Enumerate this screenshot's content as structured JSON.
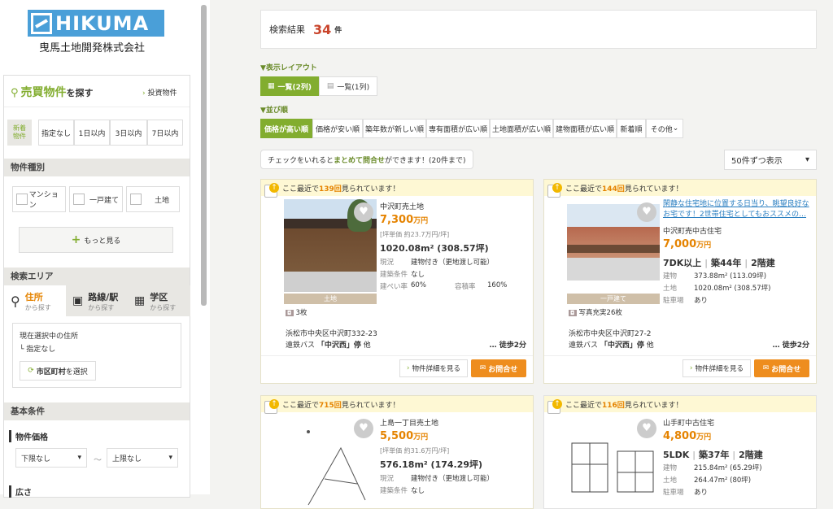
{
  "brand": {
    "logo": "HIKUMA",
    "company": "曳馬土地開発株式会社"
  },
  "sidebar": {
    "search_title": "売買物件",
    "search_suffix": "を探す",
    "invest_link": "投資物件",
    "new_label": "新着物件",
    "new_filters": [
      "指定なし",
      "1日以内",
      "3日以内",
      "7日以内"
    ],
    "type_title": "物件種別",
    "types": [
      "マンション",
      "一戸建て",
      "土地"
    ],
    "more": "もっと見る",
    "area_title": "検索エリア",
    "area_tabs": [
      {
        "label": "住所",
        "sub": "から探す"
      },
      {
        "label": "路線/駅",
        "sub": "から探す"
      },
      {
        "label": "学区",
        "sub": "から探す"
      }
    ],
    "current_label": "現在選択中の住所",
    "current_value": "└ 指定なし",
    "city_button": "市区町村",
    "city_button_suffix": "を選択",
    "basic_title": "基本条件",
    "price_label": "物件価格",
    "price_min": "下限なし",
    "price_max": "上限なし",
    "tilde": "～",
    "area_label": "広さ"
  },
  "results": {
    "label": "検索結果",
    "count": "34",
    "unit": "件"
  },
  "layout": {
    "label": "▼表示レイアウト",
    "options": [
      "一覧(2列)",
      "一覧(1列)"
    ]
  },
  "sort": {
    "label": "▼並び順",
    "options": [
      "価格が高い順",
      "価格が安い順",
      "築年数が新しい順",
      "専有面積が広い順",
      "土地面積が広い順",
      "建物面積が広い順",
      "新着順",
      "その他"
    ]
  },
  "bulk": {
    "pre": "チェックをいれると",
    "bold": "まとめて問合せ",
    "post": "ができます！(20件まで)"
  },
  "per_page": "50件ずつ表示",
  "cards": [
    {
      "views_pre": "ここ最近で",
      "views": "139回",
      "views_post": "見られています！",
      "title": "中沢町売土地",
      "price": "7,300",
      "price_unit": "万円",
      "unit_price": "[坪単価 約23.7万円/坪]",
      "area": "1020.08m² (308.57坪)",
      "k1": "現況",
      "v1": "建物付き（更地渡し可能）",
      "k2": "建築条件",
      "v2": "なし",
      "k3": "建ぺい率",
      "v3": "60%",
      "k4": "容積率",
      "v4": "160%",
      "tag": "土地",
      "photos": "3枚",
      "address": "浜松市中央区中沢町332-23",
      "bus": "遠鉄バス",
      "stop": "「中沢西」停",
      "stop_suffix": "他",
      "walk": "… 徒歩2分",
      "detail": "物件詳細を見る",
      "inquiry": "お問合せ"
    },
    {
      "views_pre": "ここ最近で",
      "views": "144回",
      "views_post": "見られています！",
      "headline": "閑静な住宅地に位置する日当り、眺望良好なお宅です！2世帯住宅としてもおススメの…",
      "title": "中沢町売中古住宅",
      "price": "7,000",
      "price_unit": "万円",
      "layout": "7DK以上",
      "age": "築44年",
      "floors": "2階建",
      "k1": "建物",
      "v1": "373.88m² (113.09坪)",
      "k2": "土地",
      "v2": "1020.08m² (308.57坪)",
      "k3": "駐車場",
      "v3": "あり",
      "tag": "一戸建て",
      "photos": "写真充実26枚",
      "address": "浜松市中央区中沢町27-2",
      "bus": "遠鉄バス",
      "stop": "「中沢西」停",
      "stop_suffix": "他",
      "walk": "… 徒歩2分",
      "detail": "物件詳細を見る",
      "inquiry": "お問合せ"
    },
    {
      "views_pre": "ここ最近で",
      "views": "715回",
      "views_post": "見られています！",
      "title": "上島一丁目売土地",
      "price": "5,500",
      "price_unit": "万円",
      "unit_price": "[坪単価 約31.6万円/坪]",
      "area": "576.18m² (174.29坪)",
      "k1": "現況",
      "v1": "建物付き（更地渡し可能）",
      "k2": "建築条件",
      "v2": "なし"
    },
    {
      "views_pre": "ここ最近で",
      "views": "116回",
      "views_post": "見られています！",
      "title": "山手町中古住宅",
      "price": "4,800",
      "price_unit": "万円",
      "layout": "5LDK",
      "age": "築37年",
      "floors": "2階建",
      "k1": "建物",
      "v1": "215.84m² (65.29坪)",
      "k2": "土地",
      "v2": "264.47m² (80坪)",
      "k3": "駐車場",
      "v3": "あり"
    }
  ]
}
